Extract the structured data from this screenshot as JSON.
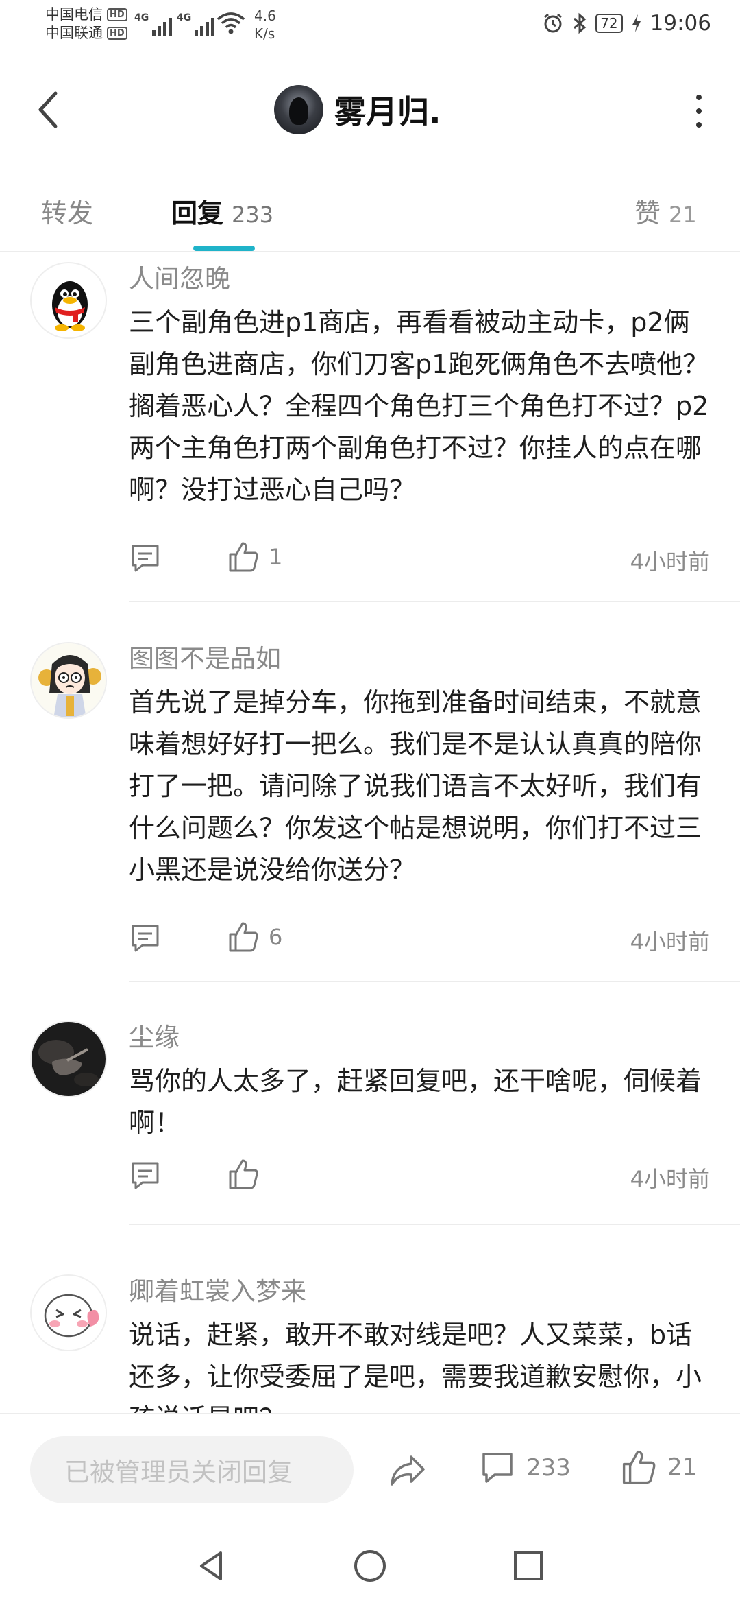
{
  "status_bar": {
    "carrier1": "中国电信",
    "carrier2": "中国联通",
    "hd_label": "HD",
    "network1": "4G",
    "network2": "4G",
    "speed_value": "4.6",
    "speed_unit": "K/s",
    "battery": "72",
    "time": "19:06"
  },
  "header": {
    "title": "雾月归.",
    "icons": {
      "back": "back-arrow-icon",
      "more": "more-vertical-icon"
    }
  },
  "tabs": {
    "forward": {
      "label": "转发"
    },
    "reply": {
      "label": "回复",
      "count": "233"
    },
    "likes": {
      "label": "赞",
      "count": "21"
    },
    "accent_color": "#1fb3c9"
  },
  "comments": [
    {
      "name": "人间忽晚",
      "text": "三个副角色进p1商店，再看看被动主动卡，p2俩副角色进商店，你们刀客p1跑死俩角色不去喷他？搁着恶心人？全程四个角色打三个角色打不过？p2两个主角色打两个副角色打不过？你挂人的点在哪啊？没打过恶心自己吗？",
      "likes": "1",
      "time": "4小时前",
      "avatar": "penguin-avatar"
    },
    {
      "name": "图图不是品如",
      "text": "首先说了是掉分车，你拖到准备时间结束，不就意味着想好好打一把么。我们是不是认认真真的陪你打了一把。请问除了说我们语言不太好听，我们有什么问题么？你发这个帖是想说明，你们打不过三小黑还是说没给你送分？",
      "likes": "6",
      "time": "4小时前",
      "avatar": "anime-girl-avatar"
    },
    {
      "name": "尘缘",
      "text": "骂你的人太多了，赶紧回复吧，还干啥呢，伺候着啊！",
      "likes": "",
      "time": "4小时前",
      "avatar": "dark-photo-avatar"
    },
    {
      "name": "卿着虹裳入梦来",
      "text": "说话，赶紧，敢开不敢对线是吧？人又菜菜，b话还多，让你受委屈了是吧，需要我道歉安慰你，小孩说话是吧？",
      "likes": "",
      "time": "",
      "avatar": "cartoon-blush-avatar"
    }
  ],
  "bottom_bar": {
    "input_placeholder": "已被管理员关闭回复",
    "comment_count": "233",
    "like_count": "21"
  },
  "nav_bar": {
    "icons": [
      "back-triangle-icon",
      "home-circle-icon",
      "recents-square-icon"
    ]
  }
}
